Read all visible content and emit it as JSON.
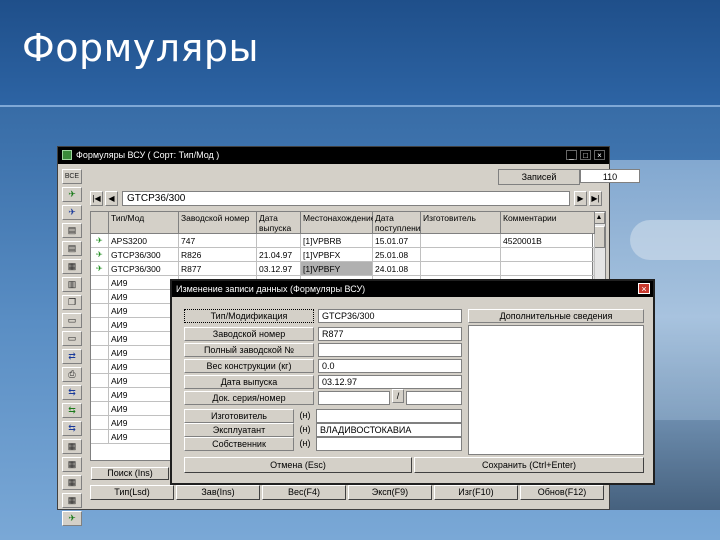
{
  "slide": {
    "title": "Формуляры"
  },
  "main_window": {
    "caption": "Формуляры ВСУ ( Сорт: Тип/Мод )",
    "cap_min": "_",
    "cap_max": "□",
    "cap_close": "×",
    "toolbar": [
      {
        "icon": "all-icon",
        "glyph": "ВСЕ",
        "color": "default"
      },
      {
        "icon": "plane-add-icon",
        "glyph": "✈",
        "color": "green"
      },
      {
        "icon": "plane-edit-icon",
        "glyph": "✈",
        "color": "blue"
      },
      {
        "icon": "doc-icon",
        "glyph": "▤",
        "color": "default"
      },
      {
        "icon": "doc-icon-2",
        "glyph": "▤",
        "color": "default"
      },
      {
        "icon": "doc-icon-3",
        "glyph": "▦",
        "color": "default"
      },
      {
        "icon": "chart-icon",
        "glyph": "▥",
        "color": "default"
      },
      {
        "icon": "copy-icon",
        "glyph": "❐",
        "color": "default"
      },
      {
        "icon": "page-icon",
        "glyph": "▭",
        "color": "default"
      },
      {
        "icon": "page-icon-2",
        "glyph": "▭",
        "color": "default"
      },
      {
        "icon": "transfer-icon",
        "glyph": "⇄",
        "color": "blue"
      },
      {
        "icon": "print-icon",
        "glyph": "⎙",
        "color": "default"
      },
      {
        "icon": "link-icon",
        "glyph": "⇆",
        "color": "blue"
      },
      {
        "icon": "link-icon-2",
        "glyph": "⇆",
        "color": "green"
      },
      {
        "icon": "link-icon-3",
        "glyph": "⇆",
        "color": "blue"
      },
      {
        "icon": "calc-icon",
        "glyph": "▦",
        "color": "default"
      },
      {
        "icon": "grid-icon",
        "glyph": "▦",
        "color": "default"
      },
      {
        "icon": "grid-icon-2",
        "glyph": "▦",
        "color": "default"
      },
      {
        "icon": "grid-icon-3",
        "glyph": "▦",
        "color": "default"
      },
      {
        "icon": "plane-icon",
        "glyph": "✈",
        "color": "green"
      }
    ],
    "records_label": "Записей",
    "records_value": "110",
    "nav": {
      "first": "|◀",
      "prev": "◀",
      "field": "GTCP36/300",
      "next": "▶",
      "last": "▶|"
    },
    "columns": [
      "Тип/Мод",
      "Заводской номер",
      "Дата выпуска",
      "Местонахождение",
      "Дата поступления",
      "Изготовитель",
      "Комментарии"
    ],
    "rows": [
      {
        "icon": true,
        "cells": [
          "APS3200",
          "747",
          "",
          "[1]VPBRB",
          "15.01.07",
          "",
          "4520001B"
        ]
      },
      {
        "icon": true,
        "cells": [
          "GTCP36/300",
          "R826",
          "21.04.97",
          "[1]VPBFX",
          "25.01.08",
          "",
          ""
        ]
      },
      {
        "icon": true,
        "cells": [
          "GTCP36/300",
          "R877",
          "03.12.97",
          "[1]VPBFY",
          "24.01.08",
          "",
          ""
        ]
      },
      {
        "icon": false,
        "cells": [
          "АИ9",
          "",
          "",
          "",
          "",
          "",
          ""
        ]
      },
      {
        "icon": false,
        "cells": [
          "АИ9",
          "",
          "",
          "",
          "",
          "",
          ""
        ]
      },
      {
        "icon": false,
        "cells": [
          "АИ9",
          "",
          "",
          "",
          "",
          "",
          ""
        ]
      },
      {
        "icon": false,
        "cells": [
          "АИ9",
          "",
          "",
          "",
          "",
          "",
          ""
        ]
      },
      {
        "icon": false,
        "cells": [
          "АИ9",
          "",
          "",
          "",
          "",
          "",
          ""
        ]
      },
      {
        "icon": false,
        "cells": [
          "АИ9",
          "",
          "",
          "",
          "",
          "",
          ""
        ]
      },
      {
        "icon": false,
        "cells": [
          "АИ9",
          "",
          "",
          "",
          "",
          "",
          ""
        ]
      },
      {
        "icon": false,
        "cells": [
          "АИ9",
          "",
          "",
          "",
          "",
          "",
          ""
        ]
      },
      {
        "icon": false,
        "cells": [
          "АИ9",
          "",
          "",
          "",
          "",
          "",
          ""
        ]
      },
      {
        "icon": false,
        "cells": [
          "АИ9",
          "",
          "",
          "",
          "",
          "",
          ""
        ]
      },
      {
        "icon": false,
        "cells": [
          "АИ9",
          "",
          "",
          "",
          "",
          "",
          ""
        ]
      },
      {
        "icon": false,
        "cells": [
          "АИ9",
          "",
          "",
          "",
          "",
          "",
          ""
        ]
      }
    ],
    "find_button": "Поиск (Ins)",
    "footer_buttons": [
      "Тип(Lsd)",
      "Зав(Ins)",
      "Вес(F4)",
      "Эксп(F9)",
      "Изг(F10)",
      "Обнов(F12)"
    ]
  },
  "dialog": {
    "caption": "Изменение записи данных (Формуляры ВСУ)",
    "close": "×",
    "fields": [
      {
        "label": "Тип/Модификация",
        "value": "GTCP36/300",
        "suffix": ""
      },
      {
        "label": "Заводской номер",
        "value": "R877",
        "suffix": ""
      },
      {
        "label": "Полный заводской №",
        "value": "",
        "suffix": ""
      },
      {
        "label": "Вес конструкции (кг)",
        "value": "0.0",
        "suffix": ""
      },
      {
        "label": "Дата выпуска",
        "value": "03.12.97",
        "suffix": ""
      },
      {
        "label": "Док. серия/номер",
        "value": "",
        "suffix": ""
      },
      {
        "label": "Изготовитель",
        "value": "",
        "suffix": "(н)"
      },
      {
        "label": "Эксплуатант",
        "value": "ВЛАДИВОСТОКАВИА",
        "suffix": "(н)"
      },
      {
        "label": "Собственник",
        "value": "",
        "suffix": "(н)"
      }
    ],
    "slash": "/",
    "addinfo_label": "Дополнительные сведения",
    "cancel_button": "Отмена (Esc)",
    "save_button": "Сохранить (Ctrl+Enter)"
  }
}
